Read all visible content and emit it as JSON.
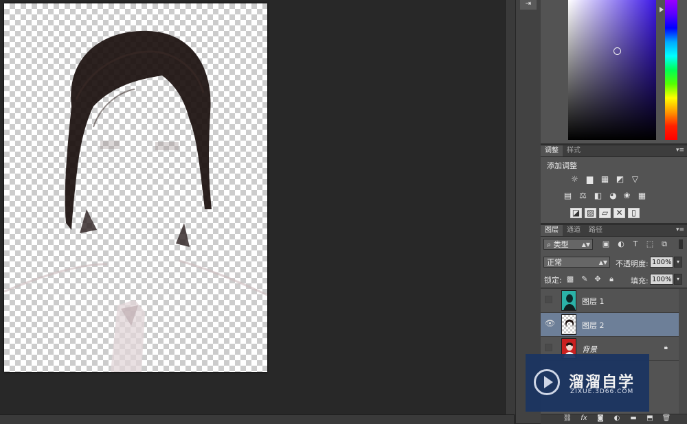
{
  "adjustments_panel": {
    "tabs": [
      "调整",
      "样式"
    ],
    "title": "添加调整"
  },
  "layers_panel": {
    "tabs": [
      "图层",
      "通道",
      "路径"
    ],
    "filter_kind": "类型",
    "blend_mode": "正常",
    "opacity_label": "不透明度:",
    "opacity_value": "100%",
    "lock_label": "锁定:",
    "fill_label": "填充:",
    "fill_value": "100%",
    "layers": [
      {
        "name": "图层 1",
        "visible": false,
        "selected": false
      },
      {
        "name": "图层 2",
        "visible": true,
        "selected": true
      },
      {
        "name": "背景",
        "visible": false,
        "selected": false,
        "locked": true
      }
    ]
  },
  "watermark": {
    "title": "溜溜自学",
    "url": "ZIXUE.3D66.COM"
  },
  "colors": {
    "selected_layer": "#6d7f98",
    "panel_bg": "#535353",
    "workspace_bg": "#282828"
  }
}
